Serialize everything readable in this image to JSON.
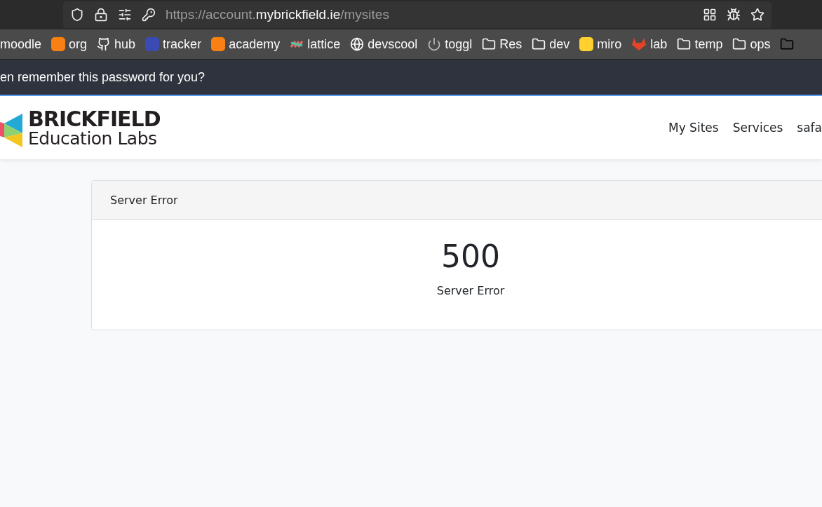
{
  "browser": {
    "url": {
      "scheme": "https://account.",
      "domain": "mybrickfield.ie",
      "path": "/mysites"
    },
    "bookmarks": [
      {
        "label": "moodle",
        "kind": "none"
      },
      {
        "label": "org",
        "kind": "app",
        "color": "#f98012"
      },
      {
        "label": "hub",
        "kind": "github"
      },
      {
        "label": "tracker",
        "kind": "app",
        "color": "#3b4bb3"
      },
      {
        "label": "academy",
        "kind": "app",
        "color": "#f98012"
      },
      {
        "label": "lattice",
        "kind": "lattice"
      },
      {
        "label": "devscool",
        "kind": "globe"
      },
      {
        "label": "toggl",
        "kind": "power"
      },
      {
        "label": "Res",
        "kind": "folder"
      },
      {
        "label": "dev",
        "kind": "folder"
      },
      {
        "label": "miro",
        "kind": "app",
        "color": "#ffd02f"
      },
      {
        "label": "lab",
        "kind": "gitlab"
      },
      {
        "label": "temp",
        "kind": "folder"
      },
      {
        "label": "ops",
        "kind": "folder"
      },
      {
        "kind": "folder"
      }
    ],
    "notification": "en remember this password for you?"
  },
  "site": {
    "logo": {
      "title": "BRICKFIELD",
      "subtitle": "Education Labs"
    },
    "nav": [
      "My Sites",
      "Services",
      "safa"
    ]
  },
  "card": {
    "header": "Server Error",
    "code": "500",
    "message": "Server Error"
  }
}
